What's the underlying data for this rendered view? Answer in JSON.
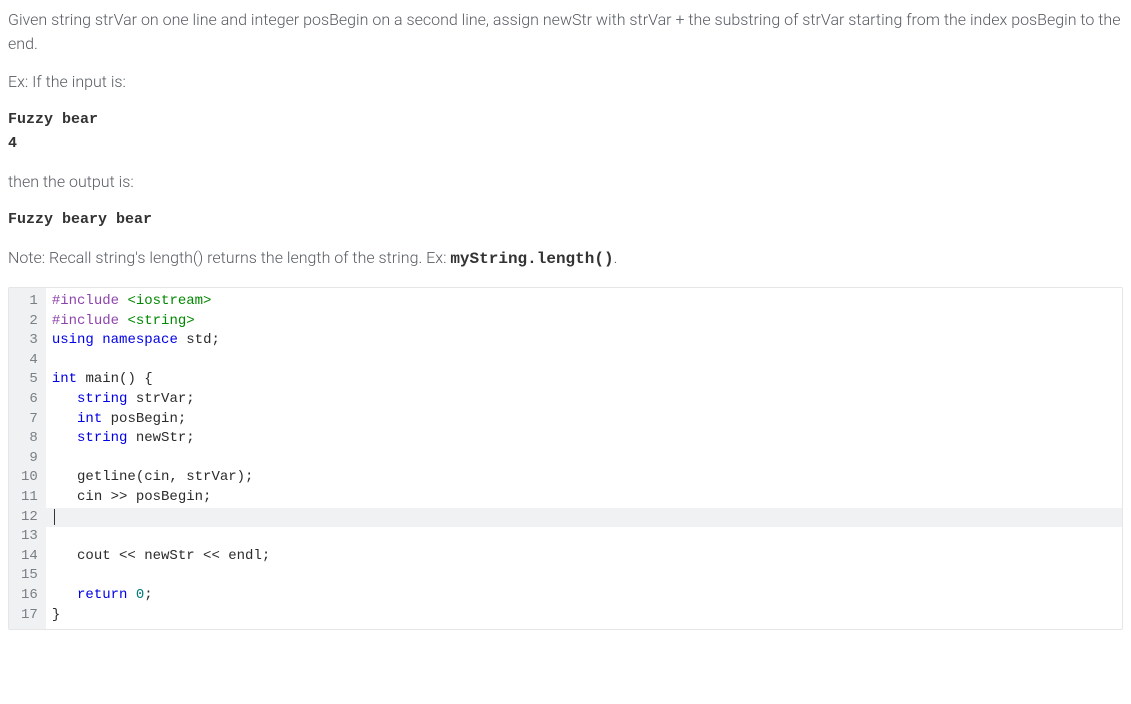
{
  "problem": {
    "description": "Given string strVar on one line and integer posBegin on a second line, assign newStr with strVar + the substring of strVar starting from the index posBegin to the end.",
    "example_intro": "Ex: If the input is:",
    "example_input_line1": "Fuzzy bear",
    "example_input_line2": "4",
    "output_intro": "then the output is:",
    "example_output": "Fuzzy beary bear",
    "note_prefix": "Note: Recall string's length() returns the length of the string. Ex: ",
    "note_code": "myString.length()",
    "note_suffix": "."
  },
  "code": {
    "lines": [
      {
        "num": "1",
        "tokens": [
          {
            "t": "#include ",
            "c": "pp"
          },
          {
            "t": "<iostream>",
            "c": "inc"
          }
        ]
      },
      {
        "num": "2",
        "tokens": [
          {
            "t": "#include ",
            "c": "pp"
          },
          {
            "t": "<string>",
            "c": "inc"
          }
        ]
      },
      {
        "num": "3",
        "tokens": [
          {
            "t": "using",
            "c": "kw"
          },
          {
            "t": " ",
            "c": "op"
          },
          {
            "t": "namespace",
            "c": "kw"
          },
          {
            "t": " ",
            "c": "op"
          },
          {
            "t": "std",
            "c": "id"
          },
          {
            "t": ";",
            "c": "op"
          }
        ]
      },
      {
        "num": "4",
        "tokens": []
      },
      {
        "num": "5",
        "tokens": [
          {
            "t": "int",
            "c": "type"
          },
          {
            "t": " ",
            "c": "op"
          },
          {
            "t": "main",
            "c": "fn"
          },
          {
            "t": "() {",
            "c": "op"
          }
        ]
      },
      {
        "num": "6",
        "tokens": [
          {
            "t": "   ",
            "c": "op"
          },
          {
            "t": "string",
            "c": "type"
          },
          {
            "t": " strVar;",
            "c": "id"
          }
        ]
      },
      {
        "num": "7",
        "tokens": [
          {
            "t": "   ",
            "c": "op"
          },
          {
            "t": "int",
            "c": "type"
          },
          {
            "t": " posBegin;",
            "c": "id"
          }
        ]
      },
      {
        "num": "8",
        "tokens": [
          {
            "t": "   ",
            "c": "op"
          },
          {
            "t": "string",
            "c": "type"
          },
          {
            "t": " newStr;",
            "c": "id"
          }
        ]
      },
      {
        "num": "9",
        "tokens": []
      },
      {
        "num": "10",
        "tokens": [
          {
            "t": "   getline(cin, strVar);",
            "c": "id"
          }
        ]
      },
      {
        "num": "11",
        "tokens": [
          {
            "t": "   cin >> posBegin;",
            "c": "id"
          }
        ]
      },
      {
        "num": "12",
        "tokens": [],
        "highlight": true,
        "cursor": true
      },
      {
        "num": "13",
        "tokens": []
      },
      {
        "num": "14",
        "tokens": [
          {
            "t": "   cout << newStr << endl;",
            "c": "id"
          }
        ]
      },
      {
        "num": "15",
        "tokens": []
      },
      {
        "num": "16",
        "tokens": [
          {
            "t": "   ",
            "c": "op"
          },
          {
            "t": "return",
            "c": "kw"
          },
          {
            "t": " ",
            "c": "op"
          },
          {
            "t": "0",
            "c": "num"
          },
          {
            "t": ";",
            "c": "op"
          }
        ]
      },
      {
        "num": "17",
        "tokens": [
          {
            "t": "}",
            "c": "op"
          }
        ]
      }
    ]
  }
}
